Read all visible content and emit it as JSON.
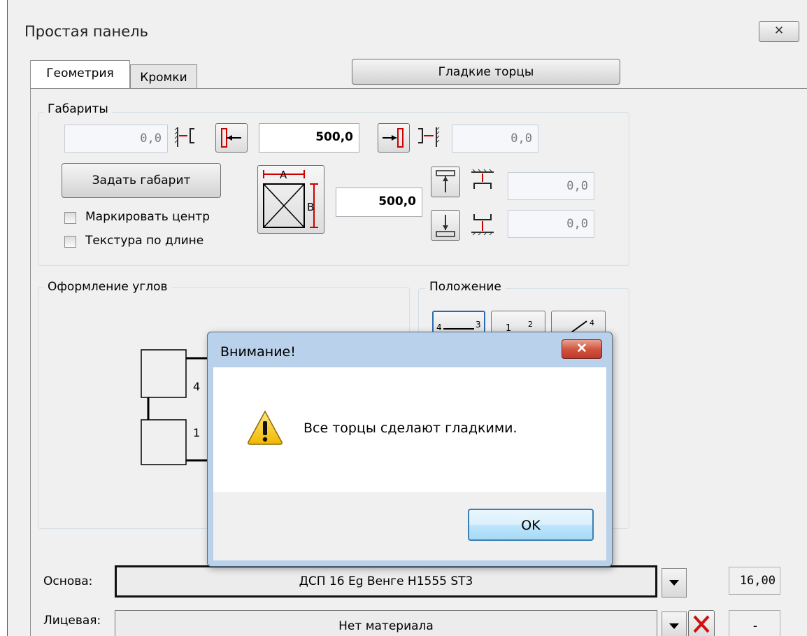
{
  "window": {
    "title": "Простая панель",
    "close_glyph": "✕"
  },
  "tabs": [
    {
      "label": "Геометрия",
      "active": true
    },
    {
      "label": "Кромки",
      "active": false
    }
  ],
  "smooth_edges_button": "Гладкие торцы",
  "dimensions": {
    "group_title": "Габариты",
    "left_offset": "0,0",
    "width_value": "500,0",
    "right_offset": "0,0",
    "set_dimension_button": "Задать габарит",
    "height_value": "500,0",
    "top_offset": "0,0",
    "bottom_offset": "0,0",
    "diagram_label_a": "A",
    "diagram_label_b": "B",
    "checkboxes": [
      {
        "label": "Маркировать центр",
        "checked": false
      },
      {
        "label": "Текстура по длине",
        "checked": false
      }
    ]
  },
  "corners": {
    "group_title": "Оформление углов",
    "corner_numbers": [
      "4",
      "1"
    ]
  },
  "position": {
    "group_title": "Положение",
    "button_labels": [
      "4",
      "3",
      "1",
      "2",
      "4"
    ]
  },
  "materials": {
    "base_label": "Основа:",
    "base_value": "ДСП 16 Eg Венге Н1555 ST3",
    "base_thickness": "16,00",
    "face_label": "Лицевая:",
    "face_value": "Нет материала",
    "face_thickness": "-"
  },
  "dialog": {
    "title": "Внимание!",
    "close_glyph": "✕",
    "message": "Все торцы сделают гладкими.",
    "ok_label": "OK",
    "icon": "warning-icon"
  },
  "colors": {
    "dialog_frame": "#b9d1ea",
    "close_red": "#c0392b",
    "marker_red": "#cc0000"
  }
}
